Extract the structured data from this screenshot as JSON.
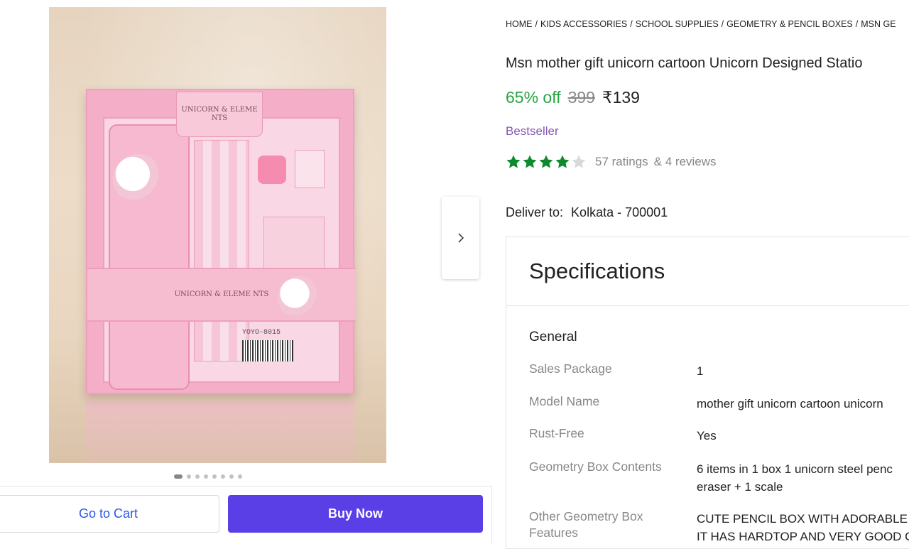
{
  "gallery": {
    "image_text_top": "UNICORN & ELEME NTS",
    "image_text_band": "UNICORN & ELEME NTS",
    "image_barcode_label": "YOYO-8015",
    "dot_count": 8,
    "active_dot": 0
  },
  "actions": {
    "go_to_cart": "Go to Cart",
    "buy_now": "Buy Now"
  },
  "breadcrumb": [
    "HOME",
    "KIDS ACCESSORIES",
    "SCHOOL SUPPLIES",
    "GEOMETRY & PENCIL BOXES",
    "MSN GE"
  ],
  "product": {
    "title": "Msn mother gift unicorn cartoon Unicorn Designed Statio",
    "discount": "65% off",
    "mrp": "399",
    "price": "₹139",
    "badge": "Bestseller",
    "rating_stars": 4,
    "ratings_text": "57 ratings",
    "reviews_text": "& 4 reviews"
  },
  "delivery": {
    "label": "Deliver to:",
    "location": "Kolkata - 700001"
  },
  "specifications": {
    "title": "Specifications",
    "group": "General",
    "rows": [
      {
        "key": "Sales Package",
        "value": [
          "1"
        ]
      },
      {
        "key": "Model Name",
        "value": [
          "mother gift unicorn cartoon unicorn"
        ]
      },
      {
        "key": "Rust-Free",
        "value": [
          "Yes"
        ]
      },
      {
        "key": "Geometry Box Contents",
        "value": [
          "6 items in 1 box 1 unicorn steel penc",
          "eraser + 1 scale"
        ]
      },
      {
        "key": "Other Geometry Box Features",
        "value": [
          "CUTE PENCIL BOX WITH ADORABLE",
          "IT HAS HARDTOP AND VERY GOOD C"
        ]
      }
    ]
  },
  "colors": {
    "discount": "#26a541",
    "badge": "#8559b5",
    "buy_button": "#5a3ee6",
    "star_filled": "#0e8a2e",
    "star_empty": "#d9d9d9"
  }
}
